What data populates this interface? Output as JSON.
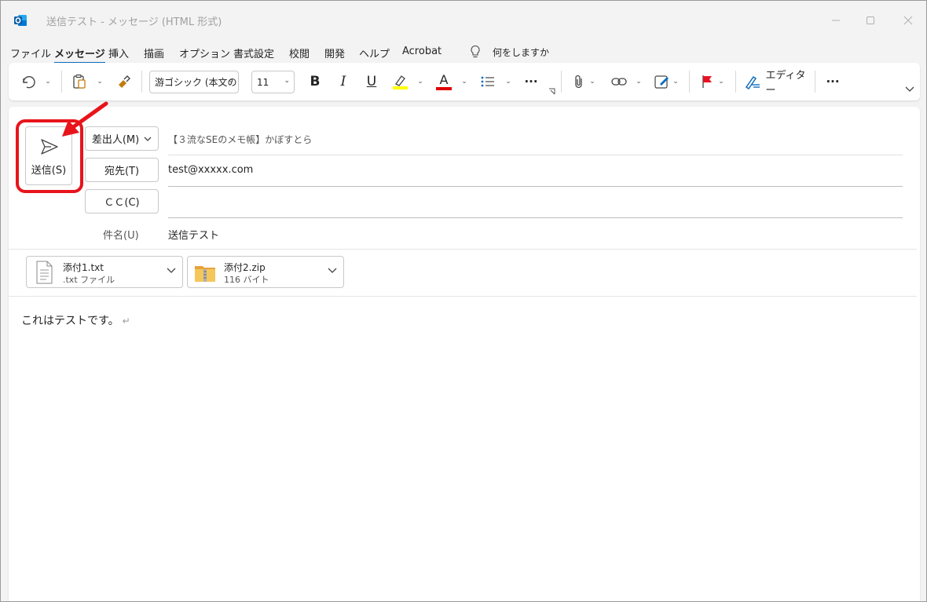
{
  "window": {
    "title": "送信テスト  -  メッセージ (HTML 形式)"
  },
  "menu": {
    "items": [
      "ファイル",
      "メッセージ",
      "挿入",
      "描画",
      "オプション",
      "書式設定",
      "校閲",
      "開発",
      "ヘルプ",
      "Acrobat"
    ],
    "active": "メッセージ",
    "search_label": "何をしますか"
  },
  "ribbon": {
    "font_name": "游ゴシック (本文の",
    "font_size": "11",
    "bold_label": "B",
    "italic_label": "I",
    "underline_label": "U",
    "font_color_label": "A",
    "editor_label": "エディター",
    "more_label": "···",
    "highlight_color": "#ffff00",
    "font_color": "#e00000"
  },
  "compose": {
    "send_label": "送信(S)",
    "from_label": "差出人(M)",
    "from_value": "【３流なSEのメモ帳】かぼすとら",
    "to_label": "宛先(T)",
    "to_value": "test@xxxxx.com",
    "cc_label": "ＣＣ(C)",
    "cc_value": "",
    "subject_label": "件名(U)",
    "subject_value": "送信テスト"
  },
  "attachments": [
    {
      "name": "添付1.txt",
      "detail": ".txt ファイル",
      "icon": "text-file-icon"
    },
    {
      "name": "添付2.zip",
      "detail": "116 バイト",
      "icon": "zip-folder-icon"
    }
  ],
  "body": {
    "text": "これはテストです。",
    "return_mark": "↵"
  },
  "colors": {
    "accent": "#0f6cbd",
    "highlight_box": "#e8141b"
  }
}
